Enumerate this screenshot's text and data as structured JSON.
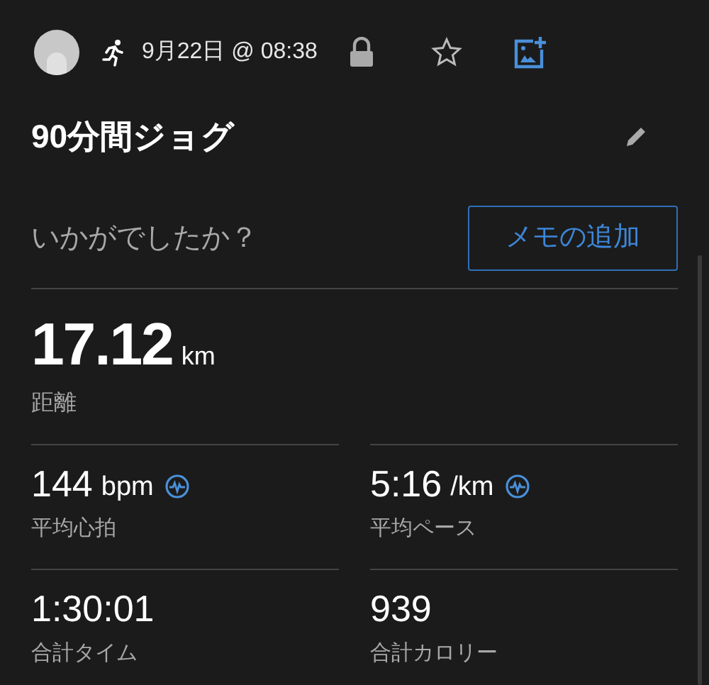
{
  "header": {
    "date": "9月22日 @ 08:38"
  },
  "title": "90分間ジョグ",
  "note": {
    "prompt": "いかがでしたか？",
    "button": "メモの追加"
  },
  "distance": {
    "value": "17.12",
    "unit": "km",
    "label": "距離"
  },
  "stats": [
    {
      "value": "144",
      "unit": "bpm",
      "label": "平均心拍",
      "graph": true
    },
    {
      "value": "5:16",
      "unit": "/km",
      "label": "平均ペース",
      "graph": true
    },
    {
      "value": "1:30:01",
      "label": "合計タイム",
      "graph": false
    },
    {
      "value": "939",
      "label": "合計カロリー",
      "graph": false
    }
  ]
}
